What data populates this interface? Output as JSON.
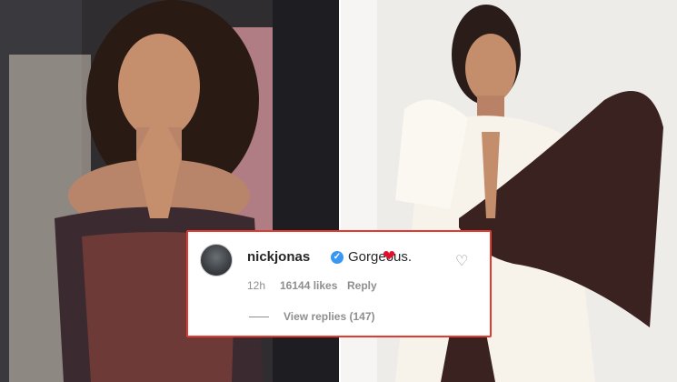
{
  "comment": {
    "username": "nickjonas",
    "text": "Gorgeous.",
    "emoji": "❤",
    "time": "12h",
    "likes": "16144 likes",
    "reply_label": "Reply",
    "view_replies": "View replies (147)"
  },
  "colors": {
    "card_border": "#e23a2f",
    "verified_badge": "#3897f0",
    "emoji_heart": "#e0102d"
  },
  "icons": {
    "verified": "verified-badge-icon",
    "like": "heart-outline-icon"
  }
}
